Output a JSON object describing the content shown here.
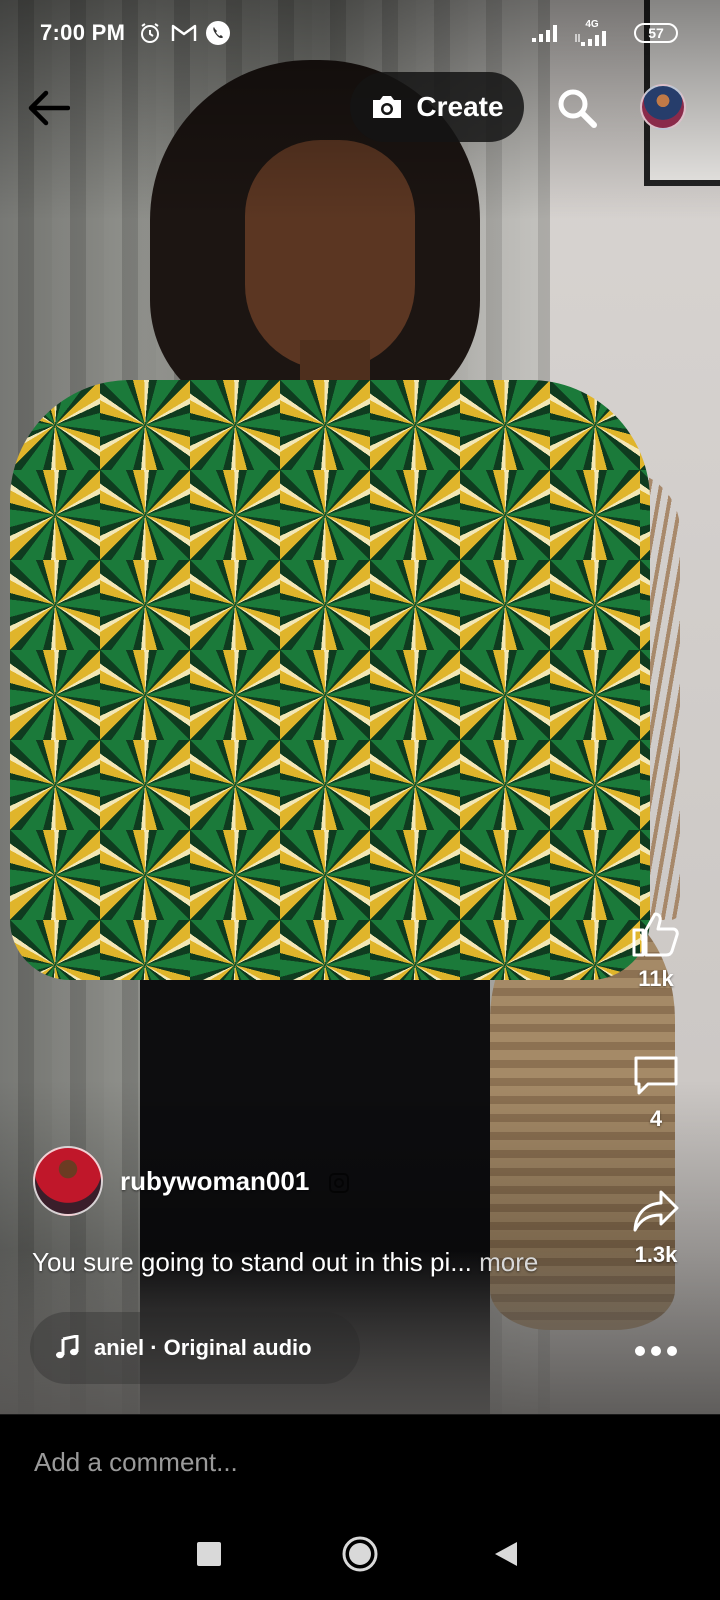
{
  "status_bar": {
    "time": "7:00 PM",
    "network_type": "4G",
    "battery": "57",
    "icons": [
      "alarm-icon",
      "gmail-icon",
      "phone-call-icon",
      "signal-icon",
      "signal-4g-icon"
    ]
  },
  "header": {
    "create_label": "Create",
    "icons": [
      "back-arrow-icon",
      "camera-icon",
      "search-icon"
    ]
  },
  "actions": {
    "like_count": "11k",
    "comment_count": "4",
    "share_count": "1.3k",
    "icons": [
      "thumbs-up-icon",
      "comment-icon",
      "share-icon",
      "more-icon"
    ]
  },
  "post": {
    "username": "rubywoman001",
    "caption": "You sure going to stand out in this pi...",
    "caption_more": "more",
    "audio_label": "aniel · Original audio"
  },
  "comment": {
    "placeholder": "Add a comment..."
  },
  "navbar": {
    "icons": [
      "recents-square-icon",
      "home-circle-icon",
      "back-triangle-icon"
    ]
  },
  "colors": {
    "background": "#000000",
    "text": "#ffffff",
    "placeholder": "#9a9a9a",
    "create_pill": "#141414"
  }
}
